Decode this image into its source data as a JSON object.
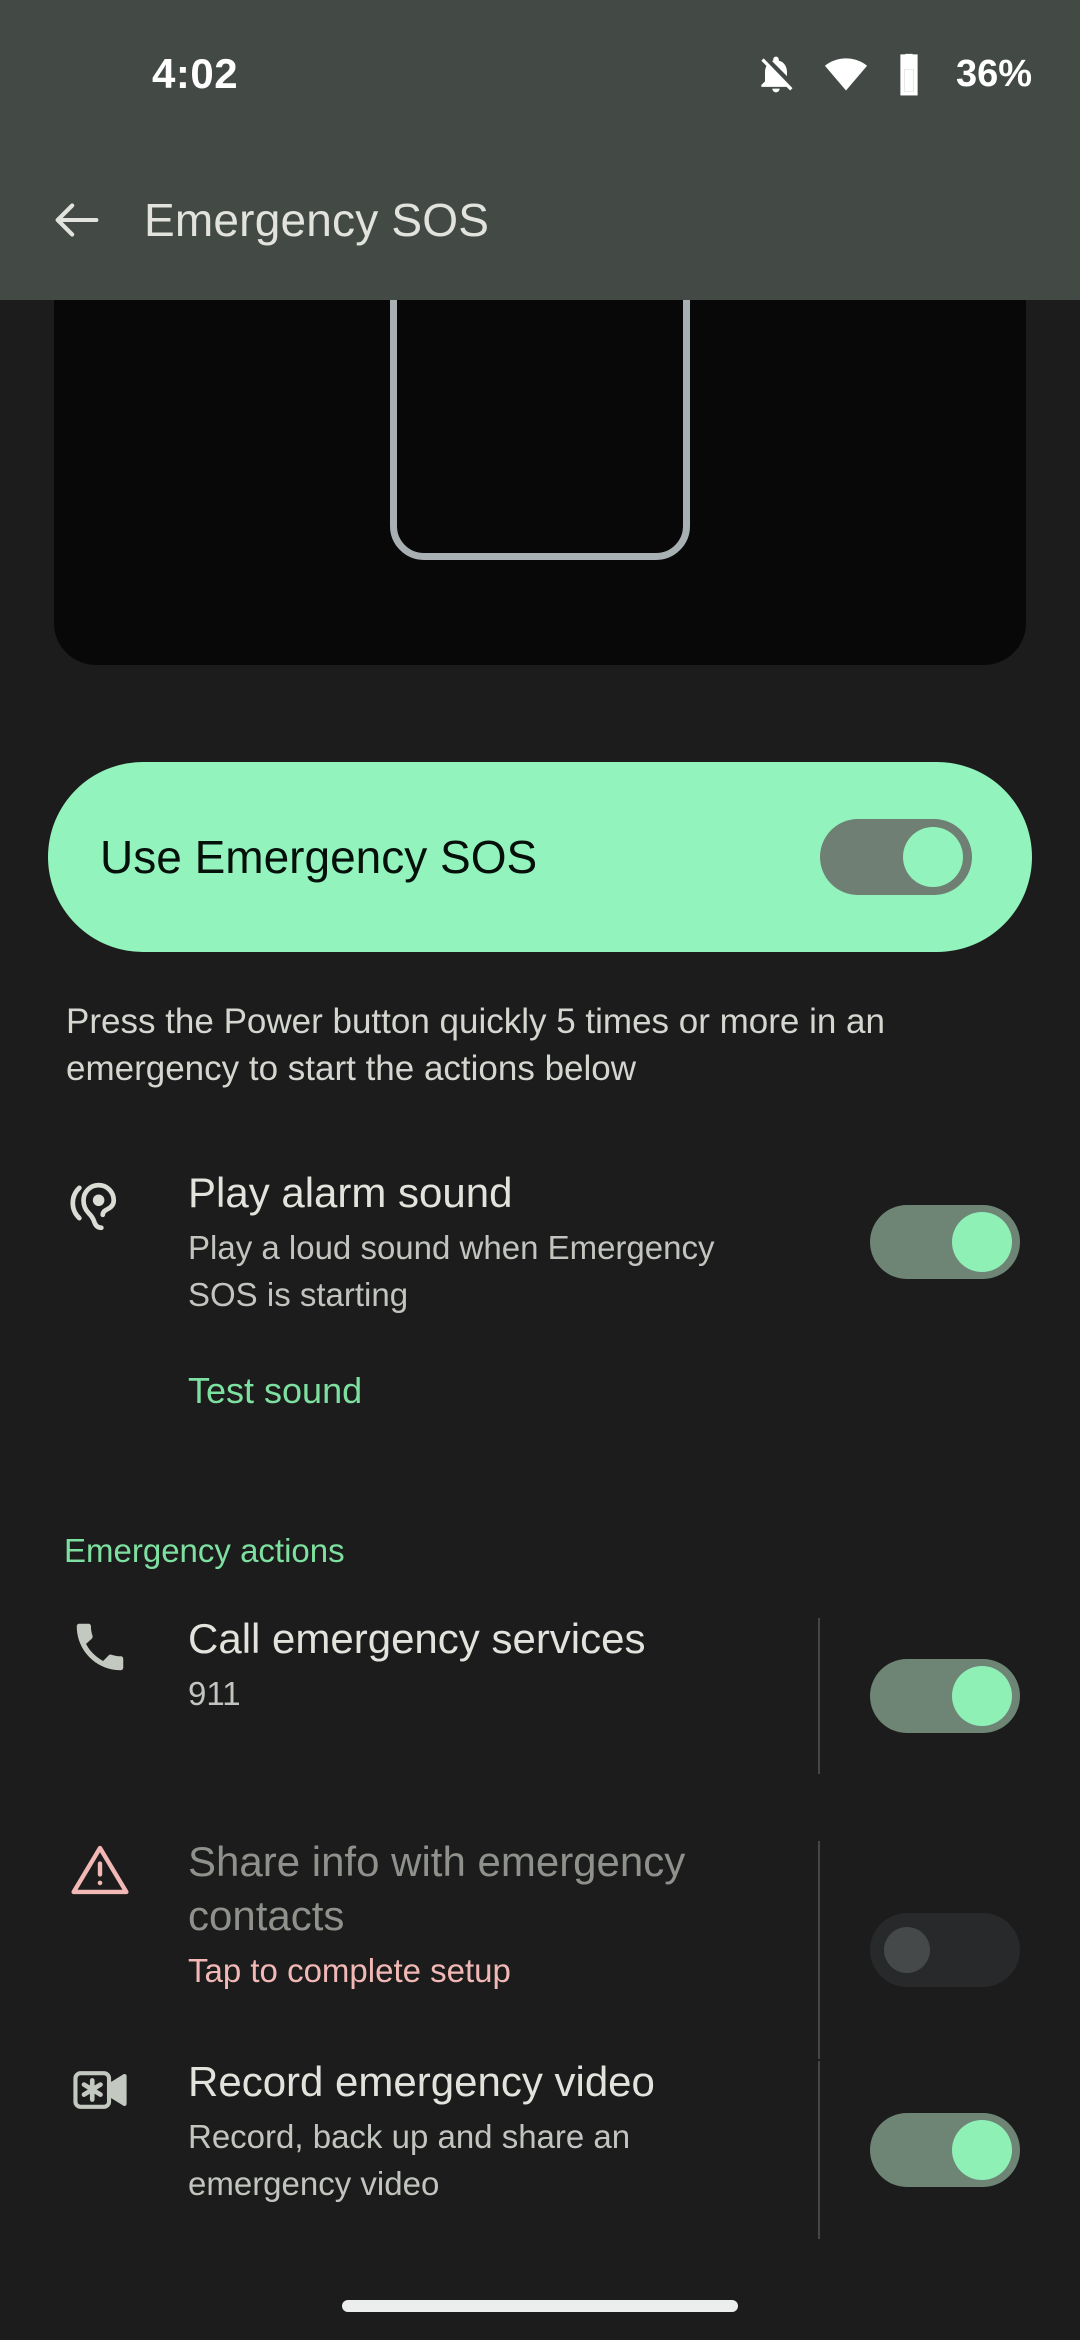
{
  "status_bar": {
    "time": "4:02",
    "battery_percent": "36%",
    "icons": [
      "notifications-off-icon",
      "wifi-icon",
      "battery-icon"
    ]
  },
  "app_bar": {
    "back_icon": "arrow-back-icon",
    "title": "Emergency SOS"
  },
  "illustration": {
    "name": "emergency-sos-illustration",
    "ring_color": "#ec5b50",
    "eye_color": "#f8d7d3",
    "phone_outline_color": "#a9b0b4",
    "background": "#080808"
  },
  "main_toggle": {
    "label": "Use Emergency SOS",
    "state": "on",
    "card_color": "#93f3bd",
    "track_color": "#6f7f73"
  },
  "description": "Press the Power button quickly 5 times or more in an emergency to start the actions below",
  "alarm": {
    "icon": "hearing-icon",
    "title": "Play alarm sound",
    "subtitle": "Play a loud sound when Emergency SOS is starting",
    "state": "on",
    "test_link": "Test sound",
    "link_color": "#7ee0a0"
  },
  "emergency_actions": {
    "header": "Emergency actions",
    "items": [
      {
        "icon": "phone-icon",
        "title": "Call emergency services",
        "subtitle": "911",
        "state": "on",
        "disabled": false
      },
      {
        "icon": "warning-triangle-icon",
        "title": "Share info with emergency contacts",
        "subtitle": "Tap to complete setup",
        "state": "off",
        "disabled": true
      },
      {
        "icon": "emergency-video-icon",
        "title": "Record emergency video",
        "subtitle": "Record, back up and share an emergency video",
        "state": "on",
        "disabled": false
      }
    ]
  },
  "nav_bar": {
    "gesture_pill": "home-gesture-pill"
  }
}
